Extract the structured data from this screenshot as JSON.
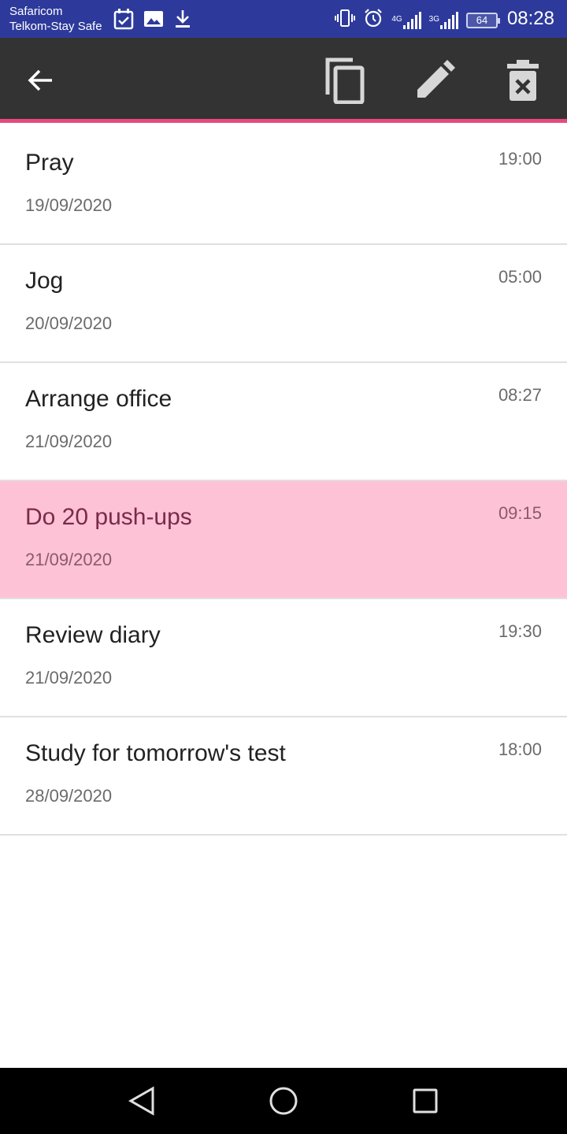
{
  "status_bar": {
    "carrier_line1": "Safaricom",
    "carrier_line2": "Telkom-Stay Safe",
    "battery": "64",
    "time": "08:28",
    "net1": "4G",
    "net2": "3G",
    "icons_left": [
      "calendar-check-icon",
      "image-icon",
      "download-icon"
    ],
    "icons_right": [
      "vibrate-icon",
      "alarm-icon",
      "signal-4g-icon",
      "signal-3g-icon",
      "battery-icon"
    ]
  },
  "app_bar": {
    "icons": [
      "back-arrow-icon",
      "copy-icon",
      "edit-icon",
      "delete-icon"
    ],
    "background": "#333333",
    "accent": "#e64980"
  },
  "tasks": [
    {
      "title": "Pray",
      "date": "19/09/2020",
      "time": "19:00",
      "selected": false
    },
    {
      "title": "Jog",
      "date": "20/09/2020",
      "time": "05:00",
      "selected": false
    },
    {
      "title": "Arrange office",
      "date": "21/09/2020",
      "time": "08:27",
      "selected": false
    },
    {
      "title": "Do 20 push-ups",
      "date": "21/09/2020",
      "time": "09:15",
      "selected": true
    },
    {
      "title": "Review diary",
      "date": "21/09/2020",
      "time": "19:30",
      "selected": false
    },
    {
      "title": "Study for tomorrow's test",
      "date": "28/09/2020",
      "time": "18:00",
      "selected": false
    }
  ],
  "colors": {
    "status_bar": "#2d3a9b",
    "selected_row": "#fdc2d6"
  },
  "nav_bar": {
    "icons": [
      "nav-back-icon",
      "nav-home-icon",
      "nav-recents-icon"
    ]
  }
}
